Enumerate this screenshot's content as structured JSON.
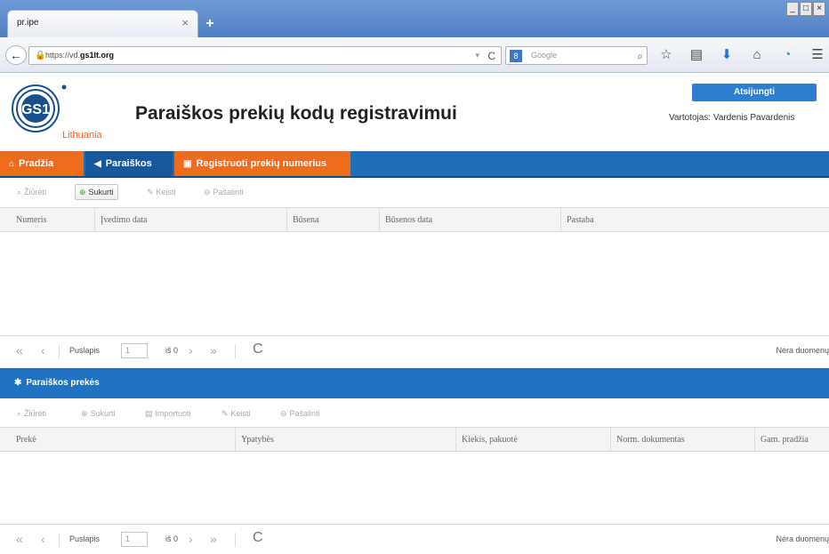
{
  "browser": {
    "tab_title": "pr.ipe",
    "tab_close": "×",
    "new_tab": "+",
    "url_prefix": "https://vd.",
    "url_domain": "gs1lt.org",
    "url_drop": "▾",
    "reload_icon": "C",
    "search_engine": "8",
    "search_placeholder": "Google",
    "search_icon": "⌕",
    "win_min": "_",
    "win_max": "□",
    "win_close": "×",
    "toolbar_icons": [
      {
        "name": "bookmark-star-icon",
        "glyph": "☆",
        "color": "#444444"
      },
      {
        "name": "reading-list-icon",
        "glyph": "▤",
        "color": "#444444"
      },
      {
        "name": "download-icon",
        "glyph": "⬇",
        "color": "#2a6fc9"
      },
      {
        "name": "home-icon",
        "glyph": "⌂",
        "color": "#444444"
      },
      {
        "name": "sync-icon",
        "glyph": "◔",
        "color": "#2a9ad8"
      },
      {
        "name": "menu-icon",
        "glyph": "☰",
        "color": "#444444"
      }
    ]
  },
  "site": {
    "logo_text": "GS1",
    "logo_sub": "Lithuania",
    "title": "Paraiškos prekių kodų registravimui",
    "login_label": "Atsijungti",
    "user_line": "Vartotojas: Vardenis Pavardenis"
  },
  "nav": {
    "home": "Pradžia",
    "applications": "Paraiškos",
    "register": "Registruoti prekių numerius"
  },
  "top_toolbar": [
    {
      "name": "view-button",
      "label": "Žiūrėti",
      "icon": "⌕",
      "active": false
    },
    {
      "name": "create-button",
      "label": "Sukurti",
      "icon": "⊕",
      "active": true
    },
    {
      "name": "edit-button",
      "label": "Keisti",
      "icon": "✎",
      "active": false
    },
    {
      "name": "delete-button",
      "label": "Pašalinti",
      "icon": "⊖",
      "active": false
    }
  ],
  "top_grid": {
    "columns": [
      "Numeris",
      "Įvedimo data",
      "Būsena",
      "Būsenos data",
      "Pastaba"
    ]
  },
  "pager": {
    "first": "«",
    "prev": "‹",
    "page_label": "Puslapis",
    "page_value": "1",
    "of_label": "iš 0",
    "next": "›",
    "last": "»",
    "reload": "C",
    "empty": "Nėra duomenų"
  },
  "bottom_panel": {
    "title": "Paraiškos prekės",
    "icon": "✱"
  },
  "bottom_toolbar": [
    {
      "name": "item-view-button",
      "label": "Žiūrėti",
      "icon": "⌕",
      "active": false
    },
    {
      "name": "item-create-button",
      "label": "Sukurti",
      "icon": "⊕",
      "active": false
    },
    {
      "name": "item-import-button",
      "label": "Importuoti",
      "icon": "▤",
      "active": false
    },
    {
      "name": "item-edit-button",
      "label": "Keisti",
      "icon": "✎",
      "active": false
    },
    {
      "name": "item-delete-button",
      "label": "Pašalinti",
      "icon": "⊖",
      "active": false
    }
  ],
  "bottom_grid": {
    "columns": [
      "Prekė",
      "Ypatybės",
      "Kiekis, pakuotė",
      "Norm. dokumentas",
      "Gam. pradžia"
    ]
  },
  "colors": {
    "brand_blue": "#1f6fb8",
    "brand_orange": "#ef6c1e"
  }
}
